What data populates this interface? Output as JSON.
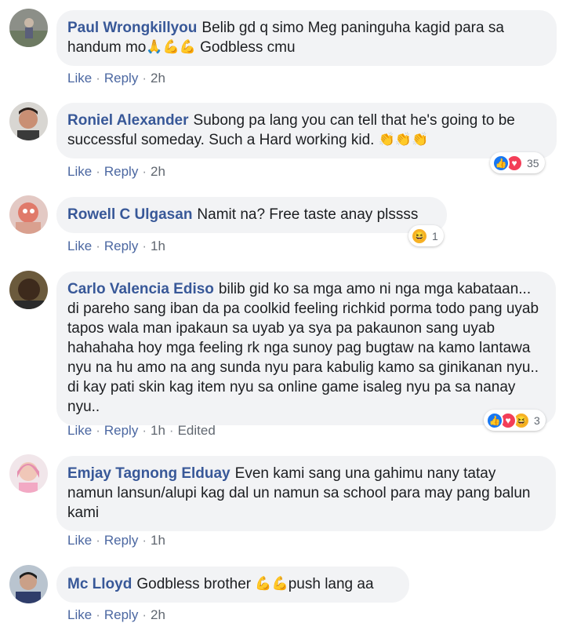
{
  "comments": [
    {
      "author": "Paul Wrongkillyou",
      "text": "Belib gd q simo Meg paninguha kagid para sa handum mo",
      "emojis": "🙏💪💪",
      "text_after": " Godbless cmu",
      "actions": {
        "like": "Like",
        "reply": "Reply",
        "time": "2h"
      }
    },
    {
      "author": "Roniel Alexander",
      "text": "Subong pa lang you can tell that he's going to be successful someday. Such a Hard working kid.",
      "emojis": "👏👏👏",
      "text_after": "",
      "actions": {
        "like": "Like",
        "reply": "Reply",
        "time": "2h"
      },
      "reactions": {
        "icons": [
          "like",
          "love"
        ],
        "count": "35"
      }
    },
    {
      "author": "Rowell C Ulgasan",
      "text": "Namit na? Free taste anay plssss",
      "emojis": "",
      "text_after": "",
      "actions": {
        "like": "Like",
        "reply": "Reply",
        "time": "1h"
      },
      "reactions": {
        "icons": [
          "haha"
        ],
        "count": "1"
      }
    },
    {
      "author": "Carlo Valencia Ediso",
      "text": "bilib gid ko sa mga amo ni nga mga kabataan... di pareho sang iban da pa coolkid feeling richkid porma todo pang uyab tapos wala man ipakaun sa uyab ya sya pa pakaunon sang uyab hahahaha hoy mga feeling rk nga sunoy pag bugtaw na kamo lantawa nyu na hu amo na ang sunda nyu para kabulig kamo sa ginikanan nyu.. di kay pati skin kag item nyu sa online game isaleg nyu pa sa nanay nyu..",
      "emojis": "",
      "text_after": "",
      "actions": {
        "like": "Like",
        "reply": "Reply",
        "time": "1h",
        "edited": "Edited"
      },
      "reactions": {
        "icons": [
          "like",
          "love",
          "haha"
        ],
        "count": "3"
      }
    },
    {
      "author": "Emjay Tagnong Elduay",
      "text": "Even kami sang una gahimu nany tatay namun lansun/alupi kag dal un namun sa school para may pang balun kami",
      "emojis": "",
      "text_after": "",
      "actions": {
        "like": "Like",
        "reply": "Reply",
        "time": "1h"
      }
    },
    {
      "author": "Mc Lloyd",
      "text": "Godbless brother ",
      "emojis": "💪💪",
      "text_after": "push lang aa",
      "actions": {
        "like": "Like",
        "reply": "Reply",
        "time": "2h"
      }
    }
  ],
  "colors": {
    "bubble": "#f2f3f5",
    "author": "#385898",
    "action_link": "#4b67a1",
    "like": "#1877f2",
    "love": "#f33e58",
    "haha": "#f7b125"
  }
}
